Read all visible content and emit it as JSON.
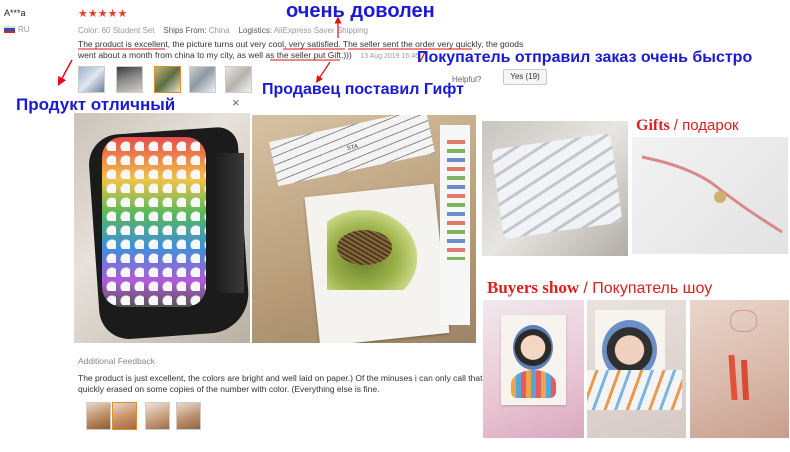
{
  "review": {
    "user": "A***a",
    "country": "RU",
    "stars": "★★★★★",
    "color_label": "Color:",
    "color_value": "60 Student Set",
    "ships_label": "Ships From:",
    "ships_value": "China",
    "logistics_label": "Logistics:",
    "logistics_value": "AliExpress Saver Shipping",
    "text_line1": "The product is excellent, the picture turns out very cool, very satisfied. The seller sent the order very quickly, the goods",
    "text_line2": "went about a month from china to my city, as well as the seller put Gift.)))",
    "date": "13 Aug 2019 16:46",
    "helpful_label": "Helpful?",
    "yes_button": "Yes (19)",
    "close": "×"
  },
  "additional": {
    "title": "Additional Feedback",
    "text_line1": "The product is just excellent, the colors are bright and well laid on paper.) Of the minuses i can only call that",
    "text_line2": "quickly erased on some copies of the number with color. (Everything else is fine."
  },
  "annotations": {
    "very_satisfied": "очень доволен",
    "seller_sent": "Покупатель отправил заказ очень быстро",
    "product_excellent": "Продукт отличный",
    "seller_gift": "Продавец поставил Гифт"
  },
  "side_labels": {
    "gifts_en": "Gifts",
    "gifts_ru": "/ подарок",
    "buyers_en": "Buyers show",
    "buyers_ru": "/ Покупатель шоу"
  },
  "photos": {
    "marker_label": "STA"
  },
  "colors": {
    "annotation_blue": "#1a1ad6",
    "arrow_red": "#e01010",
    "heading_red": "#d9211f",
    "star_red": "#e8392b"
  }
}
